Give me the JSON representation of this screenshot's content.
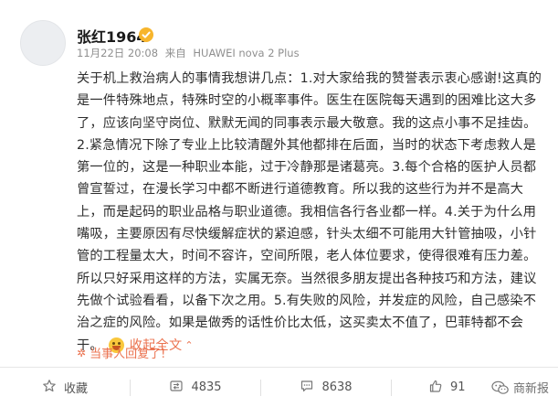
{
  "author": {
    "name": "张红1964",
    "timestamp": "11月22日 20:08",
    "source_prefix": "来自",
    "device": "HUAWEI nova 2 Plus"
  },
  "post": {
    "lines": [
      "关于机上救治病人的事情我想讲几点：1.对大家给我的赞誉表示衷心感谢!这真的",
      "是一件特殊地点，特殊时空的小概率事件。医生在医院每天遇到的困难比这大多",
      "了，应该向坚守岗位、默默无闻的同事表示最大敬意。我的这点小事不足挂齿。",
      "2.紧急情况下除了专业上比较清醒外其他都排在后面，当时的状态下考虑救人是",
      "第一位的，这是一种职业本能，过于冷静那是诸葛亮。3.每个合格的医护人员都",
      "曾宣誓过，在漫长学习中都不断进行道德教育。所以我的这些行为并不是高大",
      "上，而是起码的职业品格与职业道德。我相信各行各业都一样。4.关于为什么用",
      "嘴吸，主要原因有尽快缓解症状的紧迫感，针头太细不可能用大针管抽吸，小针",
      "管的工程量太大，时间不容许，空间所限，老人体位要求，使得很难有压力差。",
      "所以只好采用这样的方法，实属无奈。当然很多朋友提出各种技巧和方法，建议",
      "先做个试验看看，以备下次之用。5.有失败的风险，并发症的风险，自己感染不",
      "治之症的风险。如果是做秀的话性价比太低，这买卖太不值了，巴菲特都不会"
    ],
    "last_line_text": "干。",
    "collapse_label": "收起全文"
  },
  "author_reply_label": "当事人回复了!",
  "actions": {
    "favorite_label": "收藏",
    "repost_count": "4835",
    "comment_count": "8638",
    "like_count": "91"
  },
  "watermark": "商新报",
  "colors": {
    "accent": "#eb7350",
    "verified": "#f7b52c",
    "meta": "#8f8f8f"
  }
}
